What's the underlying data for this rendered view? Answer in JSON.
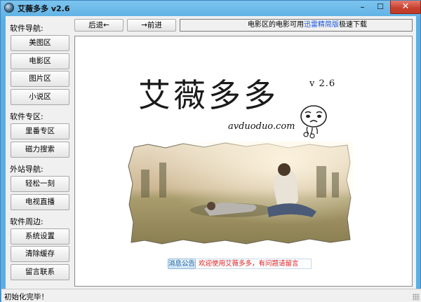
{
  "window": {
    "title": "艾薇多多 v2.6",
    "minimize_glyph": "–",
    "maximize_glyph": "☐",
    "close_glyph": "✕"
  },
  "sidebar": {
    "sections": [
      {
        "label": "软件导航:",
        "items": [
          "美图区",
          "电影区",
          "图片区",
          "小说区"
        ]
      },
      {
        "label": "软件专区:",
        "items": [
          "里番专区",
          "磁力搜索"
        ]
      },
      {
        "label": "外站导航:",
        "items": [
          "轻松一刻",
          "电视直播"
        ]
      },
      {
        "label": "软件周边:",
        "items": [
          "系统设置",
          "清除缓存",
          "留言联系"
        ]
      }
    ]
  },
  "toolbar": {
    "back_label": "后退←",
    "forward_label": "→前进",
    "notice_prefix": "电影区的电影可用",
    "notice_highlight": "迅雷精简版",
    "notice_suffix": "极速下载"
  },
  "content": {
    "logo": "艾薇多多",
    "version": "v 2.6",
    "site_url": "avduoduo.com",
    "notice_tag": "消息公告",
    "notice_message": "欢迎使用艾薇多多，有问题请留言"
  },
  "statusbar": {
    "text": "初始化完毕！"
  },
  "colors": {
    "frame": "#5aaee3",
    "close_button": "#c6402d",
    "highlight_link": "#1a55e0",
    "notice_message": "#e02020"
  },
  "icons": {
    "app_icon": "globe-icon",
    "resize_grip": "resize-grip-icon"
  }
}
